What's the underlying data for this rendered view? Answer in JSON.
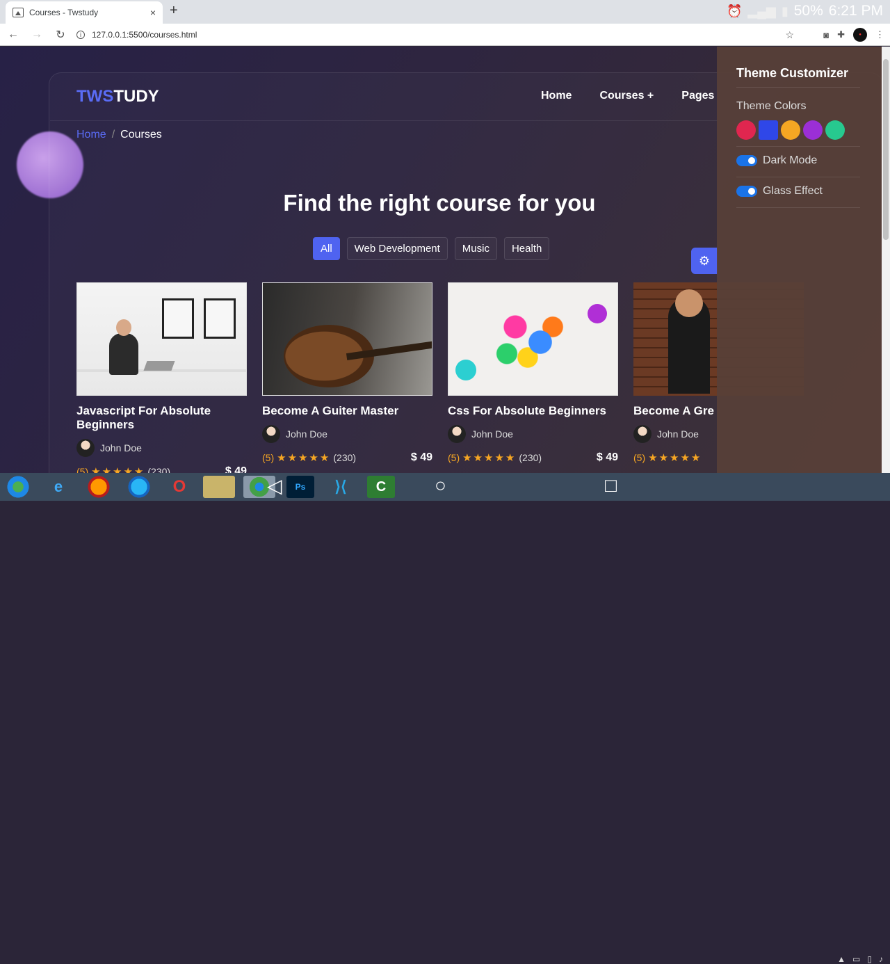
{
  "browser": {
    "tab_title": "Courses - Twstudy",
    "new_tab": "+",
    "close_tab": "×",
    "url": "127.0.0.1:5500/courses.html",
    "status_battery": "50%",
    "status_time": "6:21 PM"
  },
  "site": {
    "logo_a": "TWS",
    "logo_b": "TUDY",
    "nav": {
      "home": "Home",
      "courses": "Courses +",
      "pages": "Pages"
    },
    "breadcrumb": {
      "home": "Home",
      "sep": "/",
      "current": "Courses"
    },
    "heading": "Find the right course for you",
    "filters": [
      "All",
      "Web Development",
      "Music",
      "Health"
    ]
  },
  "courses": [
    {
      "title": "Javascript For Absolute Beginners",
      "author": "John Doe",
      "rating": "(5)",
      "stars": "★★★★★",
      "count": "(230)",
      "price": "$ 49"
    },
    {
      "title": "Become A Guiter Master",
      "author": "John Doe",
      "rating": "(5)",
      "stars": "★★★★★",
      "count": "(230)",
      "price": "$ 49"
    },
    {
      "title": "Css For Absolute Beginners",
      "author": "John Doe",
      "rating": "(5)",
      "stars": "★★★★★",
      "count": "(230)",
      "price": "$ 49"
    },
    {
      "title": "Become A Gre",
      "author": "John Doe",
      "rating": "(5)",
      "stars": "★★★★★",
      "count": "",
      "price": ""
    }
  ],
  "customizer": {
    "title": "Theme Customizer",
    "colors_label": "Theme Colors",
    "colors": [
      "#e0264f",
      "#2f47e8",
      "#f5a623",
      "#9b2fd6",
      "#27c98f"
    ],
    "dark_mode": "Dark Mode",
    "glass_effect": "Glass Effect"
  },
  "icons": {
    "gear": "⚙",
    "star": "☆",
    "reload": "↻"
  }
}
